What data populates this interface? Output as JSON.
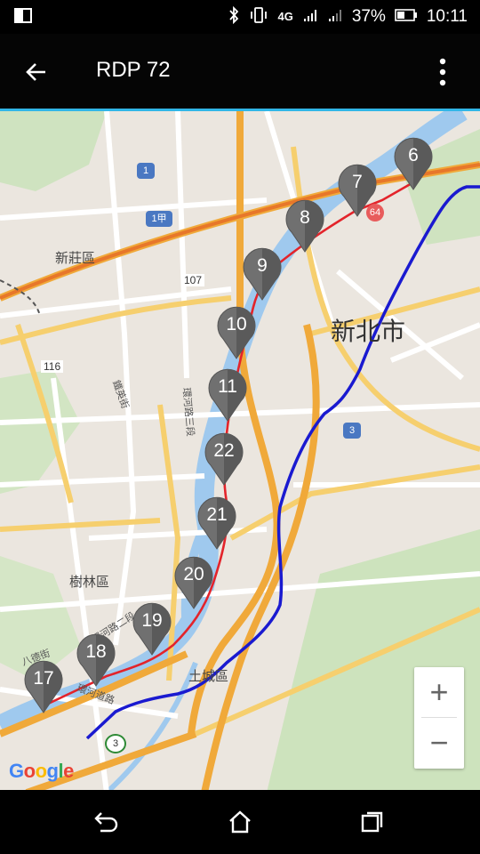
{
  "status": {
    "battery": "37%",
    "time": "10:11",
    "network": "4G"
  },
  "app_bar": {
    "title": "RDP 72"
  },
  "map": {
    "labels": {
      "xinbei": "新北市",
      "xinzhuang": "新莊區",
      "shulin": "樹林區",
      "tucheng": "土城區",
      "road_huanhe_3": "環河路三段",
      "road_huanhe_2": "環河路二段",
      "road_huanhe": "環河道路",
      "road_tieyang": "鐵英街",
      "road_bade": "八德街"
    },
    "shields": {
      "r1": "1",
      "r1a": "1甲",
      "r3_top": "3",
      "r3_bottom": "3",
      "r64": "64",
      "r107": "107",
      "r116": "116"
    },
    "markers": [
      "6",
      "7",
      "8",
      "9",
      "10",
      "11",
      "22",
      "21",
      "20",
      "19",
      "18",
      "17"
    ]
  },
  "zoom": {
    "in": "+",
    "out": "−"
  },
  "google_logo": [
    "G",
    "o",
    "o",
    "g",
    "l",
    "e"
  ],
  "colors": {
    "route_red": "#e3242b",
    "route_blue": "#1a1ad0",
    "river": "#9fc9ee",
    "highway": "#f0a93a",
    "marker": "#707070",
    "accent": "#31b6e7"
  }
}
